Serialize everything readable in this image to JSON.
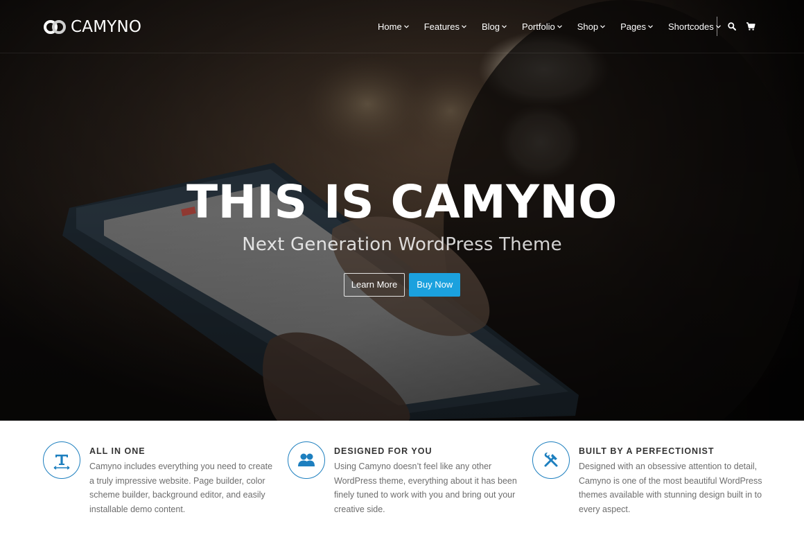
{
  "brand": {
    "name": "CAMYNO"
  },
  "nav": {
    "items": [
      {
        "label": "Home"
      },
      {
        "label": "Features"
      },
      {
        "label": "Blog"
      },
      {
        "label": "Portfolio"
      },
      {
        "label": "Shop"
      },
      {
        "label": "Pages"
      },
      {
        "label": "Shortcodes"
      }
    ],
    "icons": [
      "search-icon",
      "cart-icon"
    ]
  },
  "hero": {
    "title": "THIS IS CAMYNO",
    "subtitle": "Next Generation WordPress Theme",
    "learn_more_label": "Learn More",
    "buy_now_label": "Buy Now"
  },
  "features": [
    {
      "icon": "typography-icon",
      "title": "ALL IN ONE",
      "body": "Camyno includes everything you need to create a truly impressive website. Page builder, color scheme builder, background editor, and easily installable demo content."
    },
    {
      "icon": "users-icon",
      "title": "DESIGNED FOR YOU",
      "body": "Using Camyno doesn’t feel like any other WordPress theme, everything about it has been finely tuned to work with you and bring out your creative side."
    },
    {
      "icon": "tools-icon",
      "title": "BUILT BY A PERFECTIONIST",
      "body": "Designed with an obsessive attention to detail, Camyno is one of the most beautiful WordPress themes available with stunning design built in to every aspect."
    }
  ],
  "colors": {
    "accent": "#1ba1de",
    "icon_blue": "#1d7fbf",
    "hero_dark": "#0e0b09",
    "body_text": "#6d6d6d"
  }
}
